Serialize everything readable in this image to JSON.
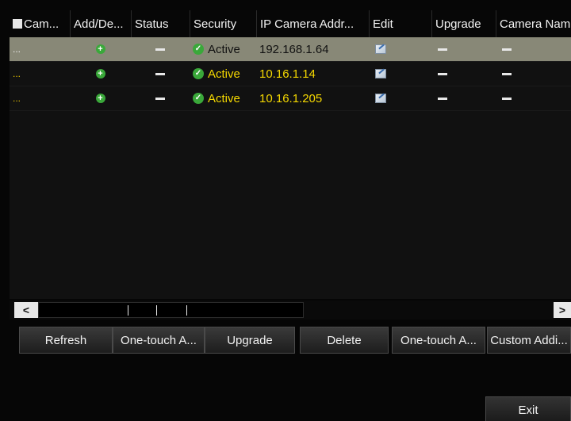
{
  "columns": [
    "Cam...",
    "Add/De...",
    "Status",
    "Security",
    "IP Camera Addr...",
    "Edit",
    "Upgrade",
    "Camera Nam"
  ],
  "rows": [
    {
      "cam": "...",
      "security": "Active",
      "ip": "192.168.1.64",
      "selected": true
    },
    {
      "cam": "...",
      "security": "Active",
      "ip": "10.16.1.14",
      "selected": false
    },
    {
      "cam": "...",
      "security": "Active",
      "ip": "10.16.1.205",
      "selected": false
    }
  ],
  "scroll": {
    "left": "<",
    "right": ">"
  },
  "buttons": {
    "refresh": "Refresh",
    "one_touch_activate": "One-touch A...",
    "upgrade": "Upgrade",
    "delete": "Delete",
    "one_touch_adding": "One-touch A...",
    "custom_adding": "Custom Addi...",
    "exit": "Exit"
  },
  "icons": {
    "add": "add-circle-icon",
    "status_dash": "dash-icon",
    "security": "check-circle-icon",
    "edit": "edit-icon"
  },
  "colors": {
    "selected_row": "#888877",
    "active_text": "#f5d800",
    "status_green": "#3aa83a"
  }
}
